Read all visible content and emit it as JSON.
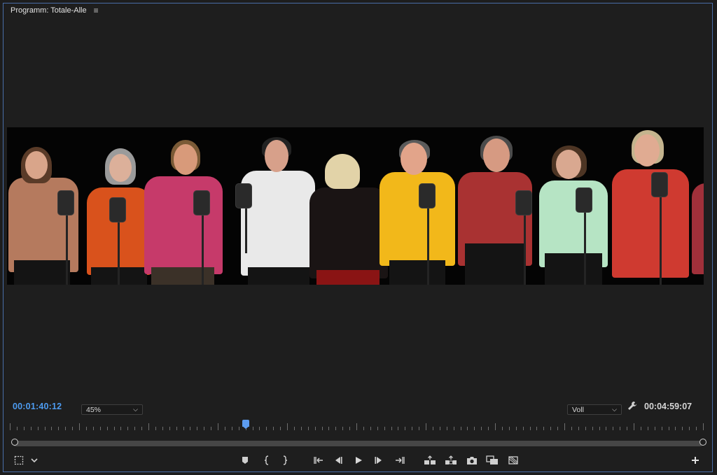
{
  "panel": {
    "title": "Programm: Totale-Alle",
    "menu_icon": "hamburger-icon"
  },
  "viewer": {
    "description": ""
  },
  "controls": {
    "current_timecode": "00:01:40:12",
    "zoom_level": "45%",
    "quality": "Voll",
    "duration": "00:04:59:07",
    "playhead_fraction": 0.34
  },
  "toolbar": {
    "icons": [
      "safe-margins-icon",
      "settings-chevron-icon",
      "add-marker-icon",
      "mark-in-icon",
      "mark-out-icon",
      "go-to-in-icon",
      "step-back-icon",
      "play-icon",
      "step-forward-icon",
      "go-to-out-icon",
      "lift-icon",
      "extract-icon",
      "export-frame-icon",
      "comparison-view-icon",
      "vr-toggle-icon",
      "add-button-icon"
    ]
  },
  "colors": {
    "accent": "#4d9bf0",
    "panel_border": "#4a6ea8",
    "background": "#1e1e1e"
  }
}
